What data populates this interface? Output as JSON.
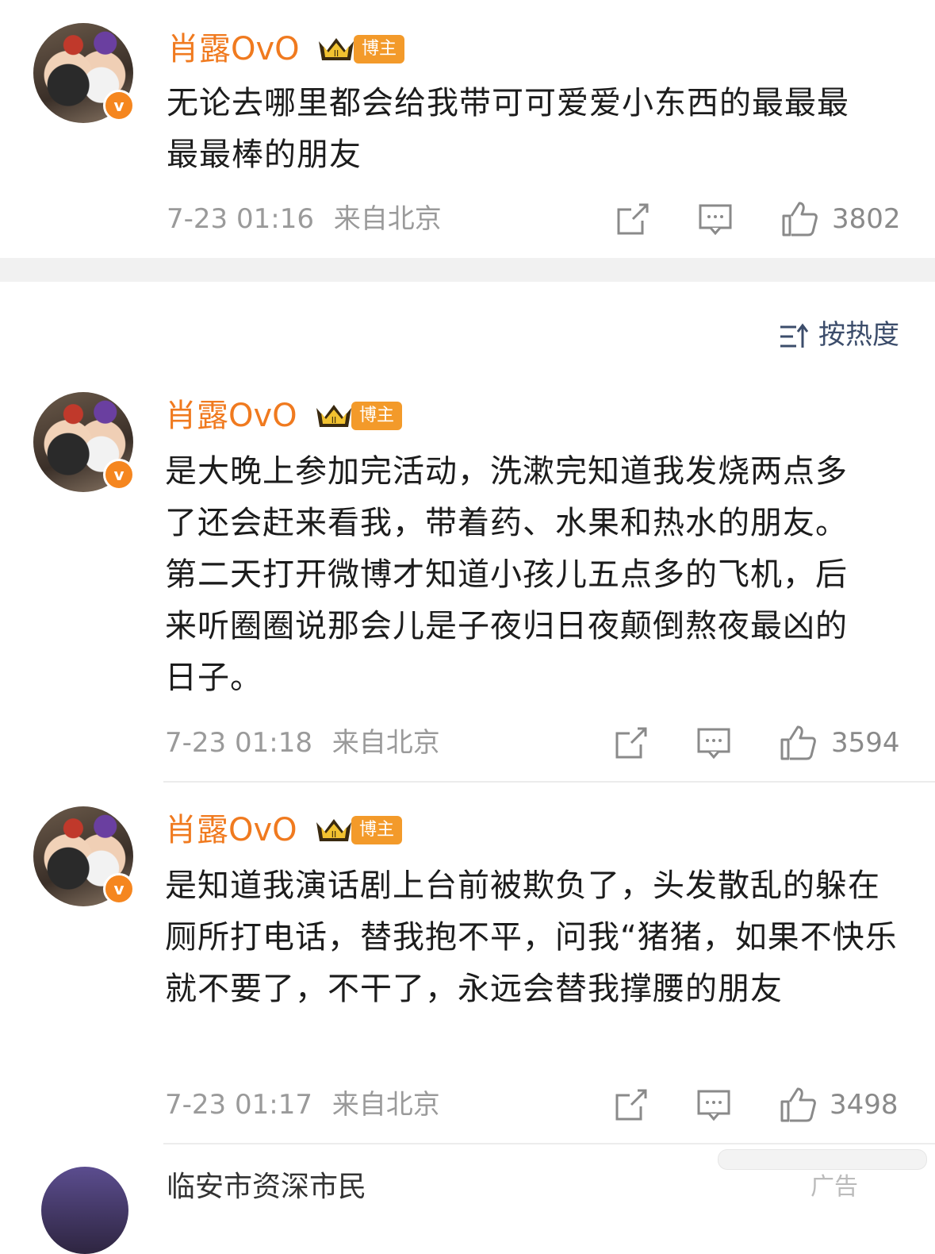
{
  "comments": [
    {
      "author": "肖露OvO",
      "badge": "博主",
      "verified": "v",
      "text": "无论去哪里都会给我带可可爱爱小东西的最最最最最棒的朋友",
      "time": "7-23 01:16",
      "location": "来自北京",
      "likes": "3802"
    },
    {
      "author": "肖露OvO",
      "badge": "博主",
      "verified": "v",
      "text": "是大晚上参加完活动，洗漱完知道我发烧两点多了还会赶来看我，带着药、水果和热水的朋友。第二天打开微博才知道小孩儿五点多的飞机，后来听圈圈说那会儿是子夜归日夜颠倒熬夜最凶的日子。",
      "time": "7-23 01:18",
      "location": "来自北京",
      "likes": "3594"
    },
    {
      "author": "肖露OvO",
      "badge": "博主",
      "verified": "v",
      "text": "是知道我演话剧上台前被欺负了，头发散乱的躲在厕所打电话，替我抱不平，问我“猪猪，如果不快乐就不要了，不干了，永远会替我撑腰的朋友",
      "time": "7-23 01:17",
      "location": "来自北京",
      "likes": "3498"
    }
  ],
  "sort": {
    "label": "按热度"
  },
  "partial": {
    "author": "临安市资深市民",
    "ad": "广告"
  },
  "colors": {
    "name": "#f07a1f",
    "badge": "#f39a2a",
    "meta": "#9a9a9a"
  }
}
